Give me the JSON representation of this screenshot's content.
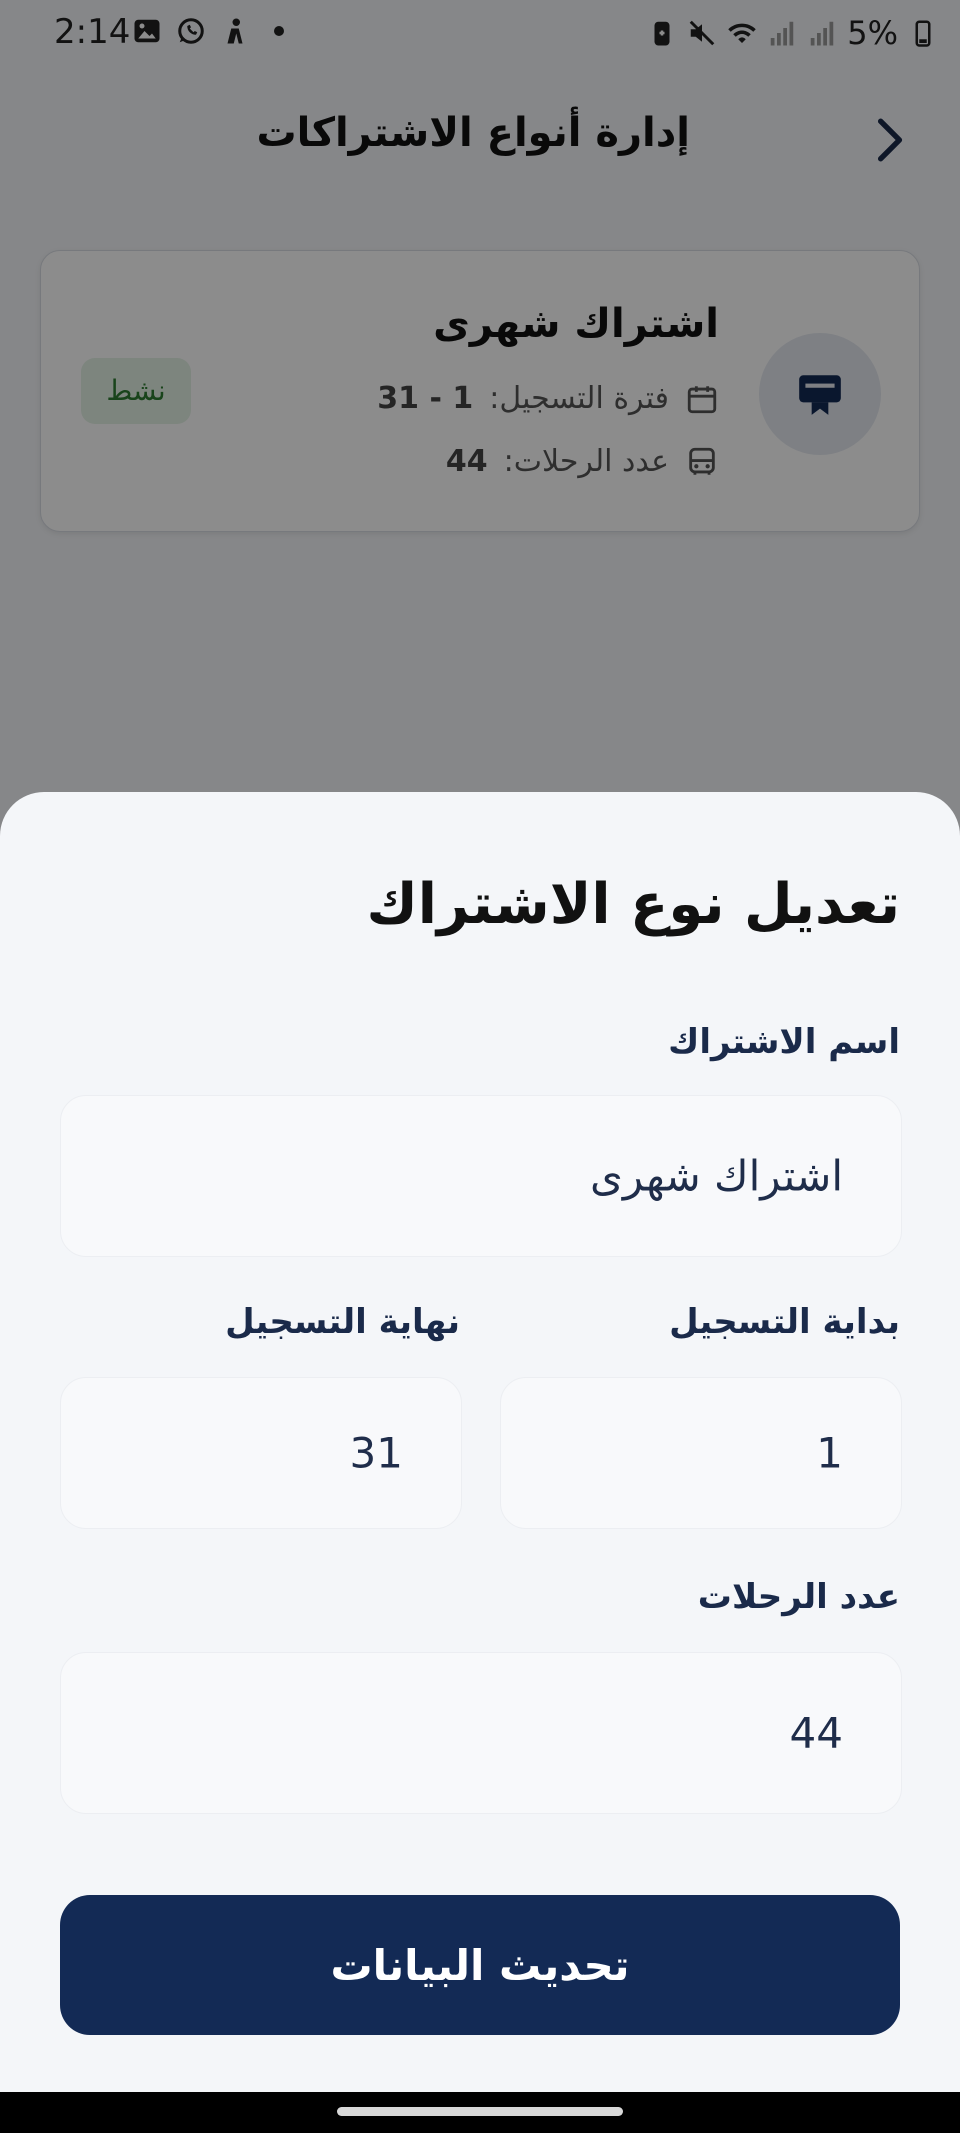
{
  "status_bar": {
    "time": "2:14",
    "battery": "5%",
    "icons": [
      "image-icon",
      "whatsapp-icon",
      "person-icon",
      "dot-icon",
      "battery-saver-icon",
      "mute-icon",
      "wifi-icon",
      "signal-icon",
      "signal-icon",
      "battery-icon"
    ]
  },
  "header": {
    "title": "إدارة أنواع الاشتراكات",
    "back_icon": "chevron-right-icon"
  },
  "card": {
    "title": "اشتراك شهرى",
    "registration_label": "فترة التسجيل:",
    "registration_value": "1 - 31",
    "trips_label": "عدد الرحلات:",
    "trips_value": "44",
    "status_badge": "نشط",
    "avatar_icon": "card-badge-icon"
  },
  "sheet": {
    "title": "تعديل نوع الاشتراك",
    "name_label": "اسم الاشتراك",
    "name_value": "اشتراك شهرى",
    "start_label": "بداية التسجيل",
    "start_value": "1",
    "end_label": "نهاية التسجيل",
    "end_value": "31",
    "trips_label": "عدد الرحلات",
    "trips_value": "44",
    "submit_label": "تحديث البيانات"
  },
  "colors": {
    "primary": "#132a55",
    "badge_bg": "#e3f2e5",
    "badge_text": "#2e7d32",
    "sheet_bg": "#f4f6f9"
  }
}
